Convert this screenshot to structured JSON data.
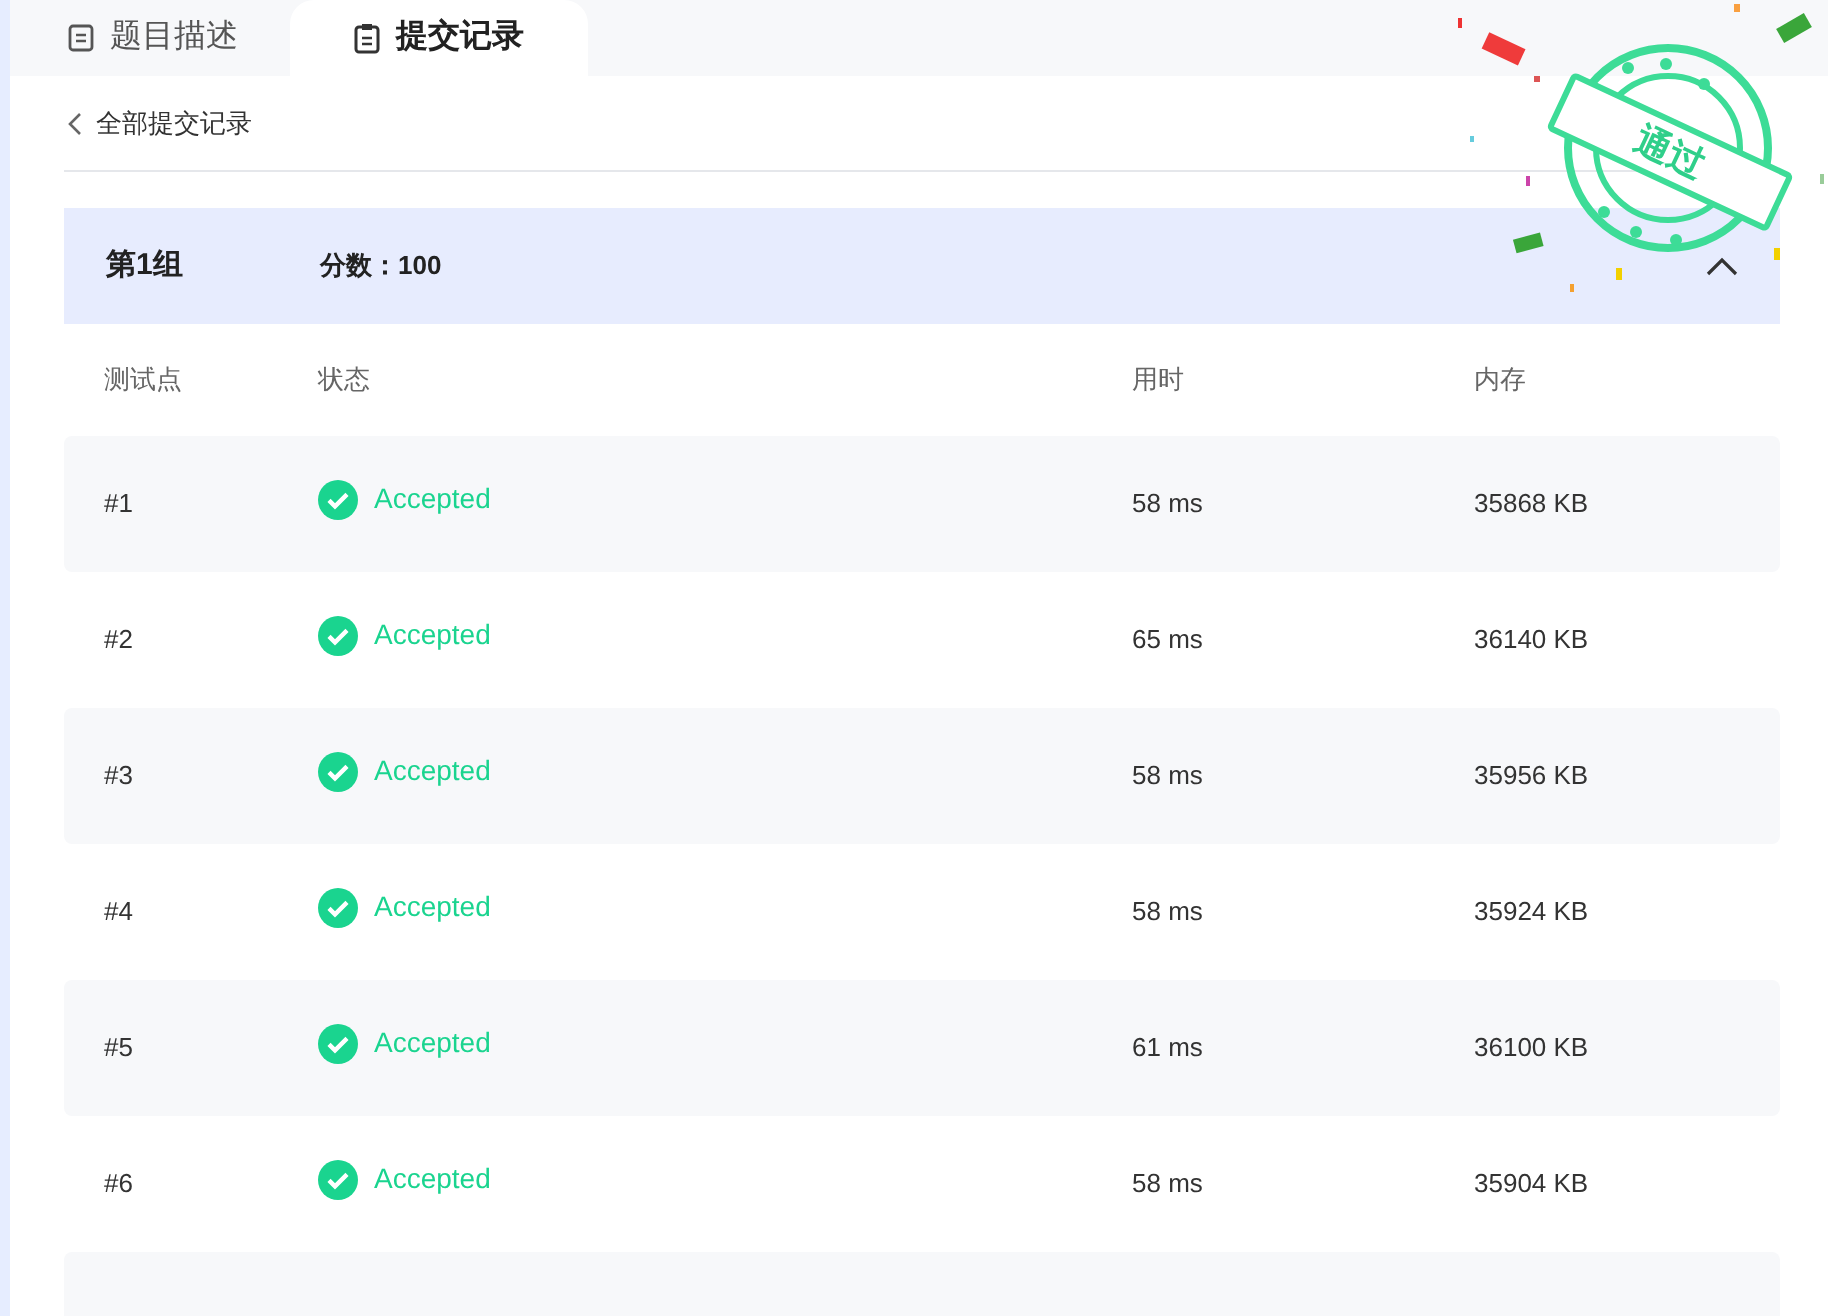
{
  "tabs": [
    {
      "label": "题目描述",
      "selected": false
    },
    {
      "label": "提交记录",
      "selected": true
    }
  ],
  "back_link": "全部提交记录",
  "stamp": "通过",
  "group": {
    "title": "第1组",
    "score_label": "分数：",
    "score": "100",
    "expanded": true
  },
  "table": {
    "columns": [
      "测试点",
      "状态",
      "用时",
      "内存"
    ],
    "rows": [
      {
        "id": "#1",
        "status": "Accepted",
        "time": "58 ms",
        "memory": "35868 KB"
      },
      {
        "id": "#2",
        "status": "Accepted",
        "time": "65 ms",
        "memory": "36140 KB"
      },
      {
        "id": "#3",
        "status": "Accepted",
        "time": "58 ms",
        "memory": "35956 KB"
      },
      {
        "id": "#4",
        "status": "Accepted",
        "time": "58 ms",
        "memory": "35924 KB"
      },
      {
        "id": "#5",
        "status": "Accepted",
        "time": "61 ms",
        "memory": "36100 KB"
      },
      {
        "id": "#6",
        "status": "Accepted",
        "time": "58 ms",
        "memory": "35904 KB"
      }
    ]
  }
}
